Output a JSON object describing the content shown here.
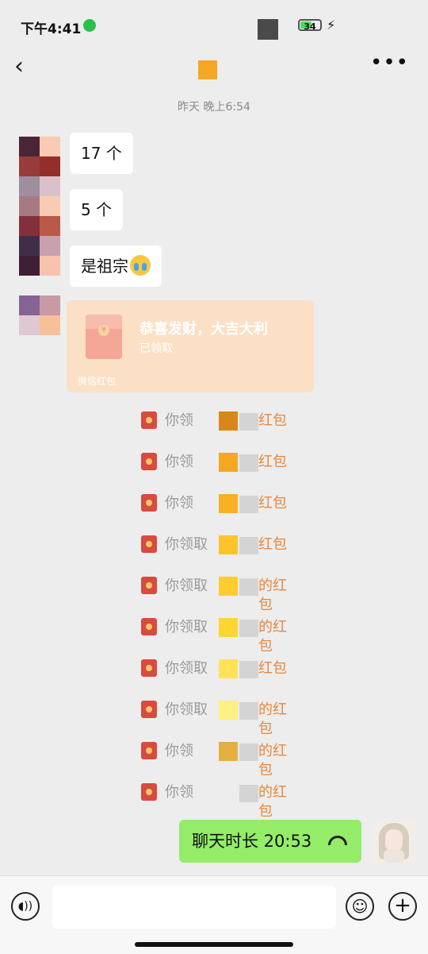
{
  "status_bar": {
    "time": "下午4:41",
    "battery": "34"
  },
  "header": {
    "back_icon": "chevron-left-icon",
    "more_icon": "more-icon",
    "title_color": "#f5a623"
  },
  "timestamp": "昨天 晚上6:54",
  "messages": [
    {
      "text": "17 个"
    },
    {
      "text": "5 个"
    },
    {
      "text": "是祖宗"
    }
  ],
  "red_packet": {
    "title": "恭喜发财，大吉大利",
    "status": "已领取",
    "footer": "微信红包",
    "coin": "¥"
  },
  "system_notes": [
    {
      "prefix": "你领",
      "suffix": "红包",
      "mask": "#d9861a"
    },
    {
      "prefix": "你领",
      "suffix": "红包",
      "mask": "#f5a623"
    },
    {
      "prefix": "你领",
      "suffix": "红包",
      "mask": "#f8b123"
    },
    {
      "prefix": "你领取",
      "suffix": "红包",
      "mask": "#fcc42a"
    },
    {
      "prefix": "你领取",
      "suffix": "的红包",
      "mask": "#fdcc2e"
    },
    {
      "prefix": "你领取",
      "suffix": "的红包",
      "mask": "#fed633"
    },
    {
      "prefix": "你领取",
      "suffix": "红包",
      "mask": "#fee25a"
    },
    {
      "prefix": "你领取",
      "suffix": "的红包",
      "mask": "#fff083"
    },
    {
      "prefix": "你领",
      "suffix": "的红包",
      "mask": "#e3b041"
    },
    {
      "prefix": "你领",
      "suffix": "的红包",
      "mask": "#ededed"
    }
  ],
  "call": {
    "text": "聊天时长 20:53"
  },
  "avatar_mosaic_colors": [
    "#4a2536",
    "#f9cbb4",
    "#973c3a",
    "#932f2a",
    "#9e8e9e",
    "#d9c1cc",
    "#a77a83",
    "#f9cbb4",
    "#82313b",
    "#b85a47",
    "#402e47",
    "#c8a0b0",
    "#3e1f36",
    "#f7c3ad",
    "#ededed",
    "#ededed",
    "#876394",
    "#c79aa6",
    "#dec8d2",
    "#f8c099"
  ]
}
